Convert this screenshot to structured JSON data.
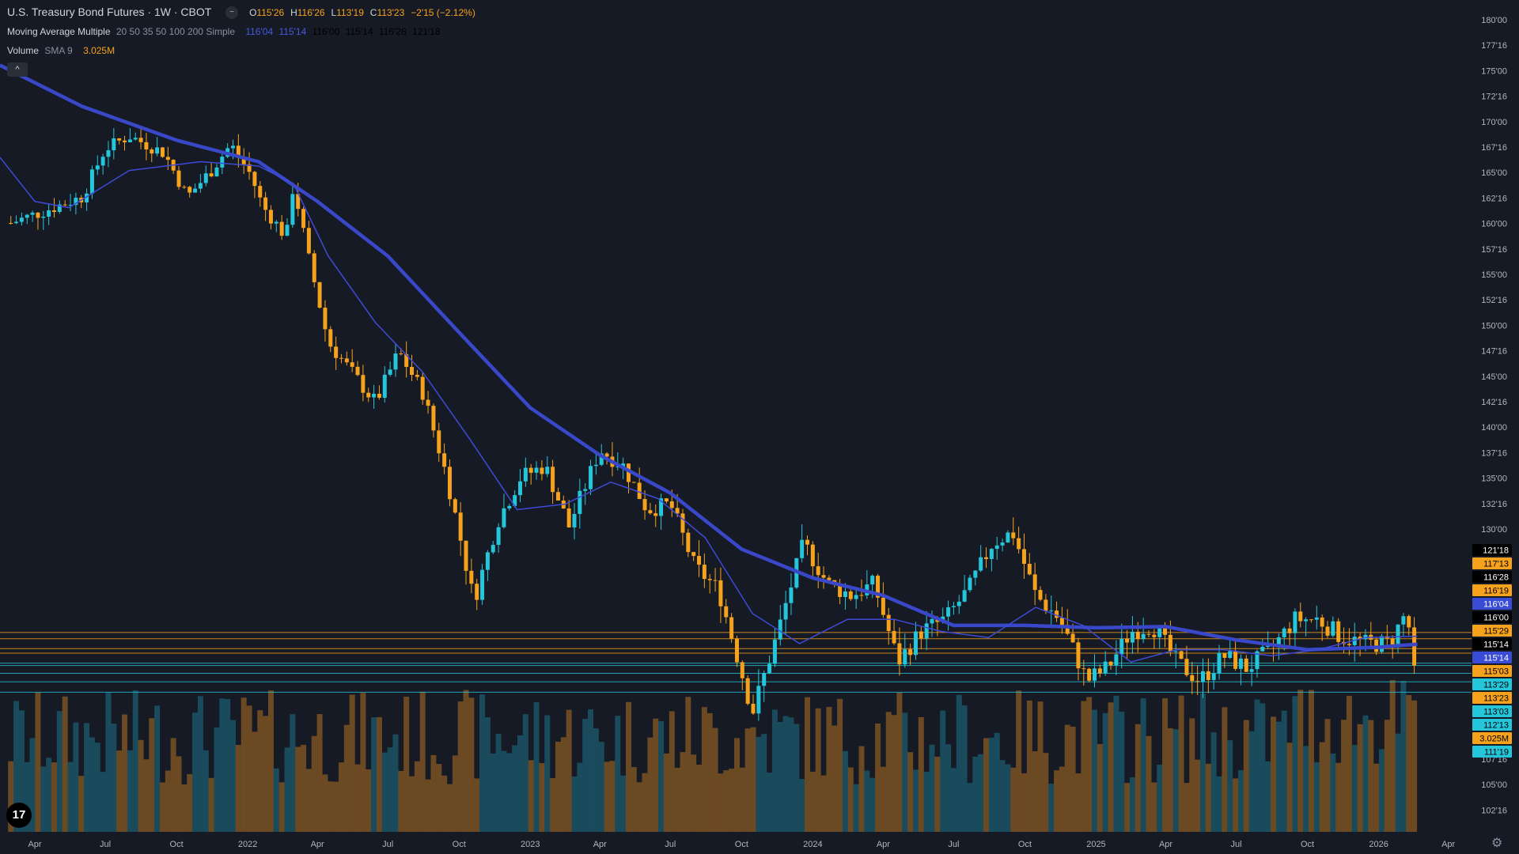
{
  "header": {
    "symbol": "U.S. Treasury Bond Futures · 1W · CBOT",
    "ohlc": {
      "o_label": "O",
      "o": "115'26",
      "h_label": "H",
      "h": "116'26",
      "l_label": "L",
      "l": "113'19",
      "c_label": "C",
      "c": "113'23",
      "change": "−2'15 (−2.12%)"
    },
    "indicator1": {
      "name": "Moving Average Multiple",
      "params": "20 50 35 50 100 200 Simple",
      "values": [
        "116'04",
        "115'14",
        "116'00",
        "115'14",
        "116'28",
        "121'18"
      ]
    },
    "indicator2": {
      "name": "Volume",
      "params": "SMA 9",
      "value": "3.025M"
    },
    "collapse_glyph": "^",
    "logo": "17"
  },
  "colors": {
    "background": "#161a25",
    "up": "#26c6da",
    "down": "#f7a21c",
    "ma_fast": "#3f4bd6",
    "ma_slow": "#3948c8",
    "volume_up": "#1b5566",
    "volume_down": "#7a5222",
    "grid": "#232733",
    "text": "#b2b5be"
  },
  "chart_data": {
    "type": "candlestick",
    "y_axis_ticks": [
      "180'00",
      "177'16",
      "175'00",
      "172'16",
      "170'00",
      "167'16",
      "165'00",
      "162'16",
      "160'00",
      "157'16",
      "155'00",
      "152'16",
      "150'00",
      "147'16",
      "145'00",
      "142'16",
      "140'00",
      "137'16",
      "135'00",
      "132'16",
      "130'00",
      "107'16",
      "105'00",
      "102'16"
    ],
    "x_axis_ticks": [
      "Apr",
      "Jul",
      "Oct",
      "2022",
      "Apr",
      "Jul",
      "Oct",
      "2023",
      "Apr",
      "Jul",
      "Oct",
      "2024",
      "Apr",
      "Jul",
      "Oct",
      "2025",
      "Apr",
      "Jul",
      "Oct",
      "2026",
      "Apr"
    ],
    "price_tags": [
      {
        "label": "121'18",
        "kind": "black"
      },
      {
        "label": "117'13",
        "kind": "orange"
      },
      {
        "label": "116'28",
        "kind": "black"
      },
      {
        "label": "116'19",
        "kind": "orange"
      },
      {
        "label": "116'04",
        "kind": "blue"
      },
      {
        "label": "116'00",
        "kind": "black"
      },
      {
        "label": "115'29",
        "kind": "orange"
      },
      {
        "label": "115'14",
        "kind": "black"
      },
      {
        "label": "115'14",
        "kind": "blue"
      },
      {
        "label": "115'03",
        "kind": "orange"
      },
      {
        "label": "113'29",
        "kind": "cyan"
      },
      {
        "label": "113'23",
        "kind": "orange"
      },
      {
        "label": "113'03",
        "kind": "cyan"
      },
      {
        "label": "112'13",
        "kind": "cyan"
      },
      {
        "label": "3.025M",
        "kind": "orange"
      },
      {
        "label": "111'19",
        "kind": "cyan"
      }
    ],
    "weekly_close_path": [
      [
        "2021-03-01",
        155.6
      ],
      [
        "2021-04-15",
        157.0
      ],
      [
        "2021-06-01",
        158.5
      ],
      [
        "2021-07-01",
        164.0
      ],
      [
        "2021-08-01",
        165.5
      ],
      [
        "2021-09-15",
        163.5
      ],
      [
        "2021-10-15",
        158.5
      ],
      [
        "2021-11-15",
        161.5
      ],
      [
        "2021-12-10",
        164.5
      ],
      [
        "2022-01-05",
        161.0
      ],
      [
        "2022-01-20",
        157.5
      ],
      [
        "2022-02-20",
        154.0
      ],
      [
        "2022-03-01",
        160.0
      ],
      [
        "2022-03-20",
        152.0
      ],
      [
        "2022-04-15",
        143.0
      ],
      [
        "2022-05-15",
        140.0
      ],
      [
        "2022-06-15",
        137.0
      ],
      [
        "2022-07-15",
        142.0
      ],
      [
        "2022-08-15",
        138.0
      ],
      [
        "2022-09-15",
        130.0
      ],
      [
        "2022-10-20",
        119.0
      ],
      [
        "2022-11-20",
        126.0
      ],
      [
        "2022-12-20",
        130.0
      ],
      [
        "2023-01-20",
        131.0
      ],
      [
        "2023-02-20",
        125.5
      ],
      [
        "2023-04-01",
        132.5
      ],
      [
        "2023-05-01",
        131.0
      ],
      [
        "2023-06-01",
        127.0
      ],
      [
        "2023-07-01",
        127.5
      ],
      [
        "2023-08-01",
        122.0
      ],
      [
        "2023-09-01",
        120.0
      ],
      [
        "2023-10-15",
        110.0
      ],
      [
        "2023-11-15",
        116.0
      ],
      [
        "2023-12-20",
        124.0
      ],
      [
        "2024-01-20",
        120.5
      ],
      [
        "2024-02-20",
        119.5
      ],
      [
        "2024-03-20",
        120.5
      ],
      [
        "2024-04-20",
        114.0
      ],
      [
        "2024-05-20",
        116.5
      ],
      [
        "2024-06-20",
        117.5
      ],
      [
        "2024-07-20",
        120.0
      ],
      [
        "2024-08-20",
        124.0
      ],
      [
        "2024-09-15",
        125.0
      ],
      [
        "2024-10-15",
        119.5
      ],
      [
        "2024-11-15",
        117.5
      ],
      [
        "2024-12-20",
        112.5
      ],
      [
        "2025-01-15",
        113.5
      ],
      [
        "2025-02-15",
        116.5
      ],
      [
        "2025-03-15",
        117.0
      ],
      [
        "2025-04-15",
        114.0
      ],
      [
        "2025-05-15",
        112.5
      ],
      [
        "2025-06-15",
        114.5
      ],
      [
        "2025-07-15",
        113.5
      ],
      [
        "2025-08-15",
        115.0
      ],
      [
        "2025-09-15",
        117.5
      ],
      [
        "2025-10-15",
        117.5
      ],
      [
        "2025-11-15",
        116.0
      ],
      [
        "2025-12-15",
        115.5
      ],
      [
        "2026-01-15",
        115.5
      ],
      [
        "2026-02-05",
        118.0
      ],
      [
        "2026-02-20",
        113.7
      ]
    ],
    "ma_fast_path": [
      [
        "2021-02-15",
        163.0
      ],
      [
        "2021-04-01",
        158.0
      ],
      [
        "2021-05-15",
        157.3
      ],
      [
        "2021-08-01",
        161.5
      ],
      [
        "2021-11-01",
        162.5
      ],
      [
        "2022-01-15",
        162.0
      ],
      [
        "2022-03-01",
        160.0
      ],
      [
        "2022-04-15",
        152.0
      ],
      [
        "2022-06-15",
        145.0
      ],
      [
        "2022-08-15",
        140.0
      ],
      [
        "2022-10-15",
        133.5
      ],
      [
        "2022-12-15",
        127.0
      ],
      [
        "2023-02-15",
        127.5
      ],
      [
        "2023-04-15",
        129.5
      ],
      [
        "2023-06-15",
        128.0
      ],
      [
        "2023-08-15",
        124.5
      ],
      [
        "2023-10-15",
        118.0
      ],
      [
        "2023-12-15",
        115.5
      ],
      [
        "2024-02-15",
        117.5
      ],
      [
        "2024-04-15",
        117.5
      ],
      [
        "2024-06-15",
        116.5
      ],
      [
        "2024-08-15",
        116.0
      ],
      [
        "2024-10-15",
        118.5
      ],
      [
        "2024-12-15",
        117.0
      ],
      [
        "2025-02-15",
        114.0
      ],
      [
        "2025-04-15",
        115.0
      ],
      [
        "2025-06-15",
        115.0
      ],
      [
        "2025-08-15",
        114.5
      ],
      [
        "2025-10-15",
        115.0
      ],
      [
        "2025-12-15",
        116.0
      ],
      [
        "2026-02-20",
        116.1
      ]
    ],
    "ma_slow_path": [
      [
        "2021-02-15",
        174.0
      ],
      [
        "2021-06-01",
        169.0
      ],
      [
        "2021-10-01",
        165.0
      ],
      [
        "2022-01-15",
        162.5
      ],
      [
        "2022-04-01",
        158.0
      ],
      [
        "2022-07-01",
        152.0
      ],
      [
        "2022-10-01",
        144.0
      ],
      [
        "2023-01-01",
        136.5
      ],
      [
        "2023-04-01",
        132.0
      ],
      [
        "2023-07-01",
        128.5
      ],
      [
        "2023-10-01",
        123.5
      ],
      [
        "2024-01-01",
        121.0
      ],
      [
        "2024-04-01",
        119.5
      ],
      [
        "2024-07-01",
        117.0
      ],
      [
        "2024-10-01",
        117.0
      ],
      [
        "2025-01-01",
        116.8
      ],
      [
        "2025-04-01",
        116.9
      ],
      [
        "2025-07-01",
        115.8
      ],
      [
        "2025-10-01",
        115.0
      ],
      [
        "2026-01-01",
        115.2
      ],
      [
        "2026-02-20",
        115.45
      ]
    ],
    "horizontal_levels": [
      {
        "value": 116.41,
        "kind": "orange"
      },
      {
        "value": 115.9,
        "kind": "orange"
      },
      {
        "value": 115.09,
        "kind": "orange"
      },
      {
        "value": 114.72,
        "kind": "orange"
      },
      {
        "value": 113.91,
        "kind": "cyan"
      },
      {
        "value": 113.72,
        "kind": "cyan"
      },
      {
        "value": 113.09,
        "kind": "cyan"
      },
      {
        "value": 112.41,
        "kind": "cyan"
      },
      {
        "value": 111.59,
        "kind": "cyan"
      }
    ],
    "x_range": [
      "2021-02-15",
      "2026-05-01"
    ],
    "y_scale": "log",
    "grid": false
  }
}
